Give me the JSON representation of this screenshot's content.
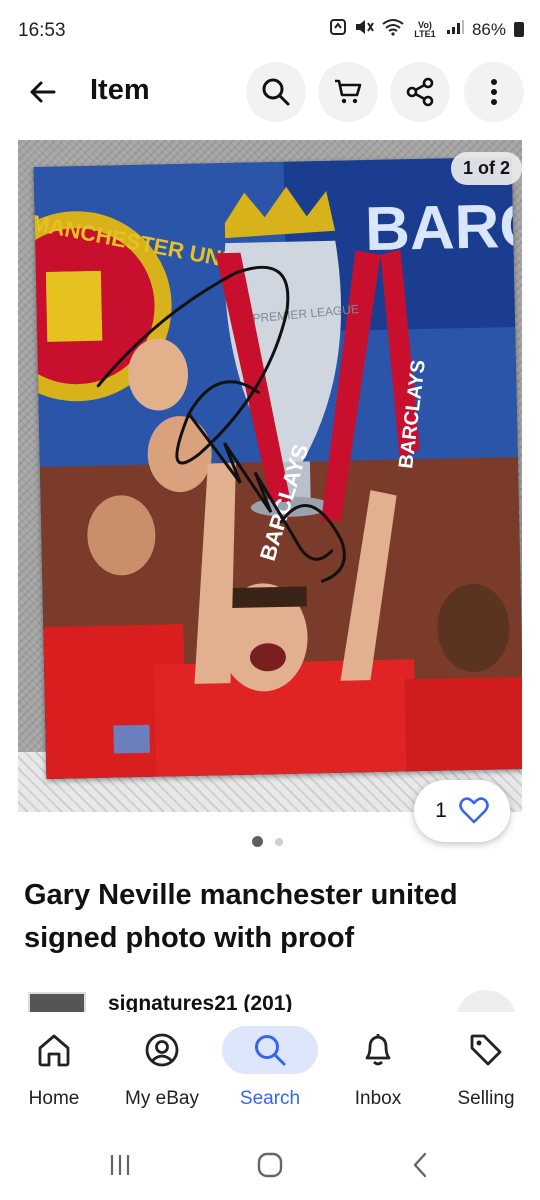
{
  "status_bar": {
    "time": "16:53",
    "network": "Vo) LTE1",
    "battery": "86%"
  },
  "app_bar": {
    "title": "Item",
    "icons": [
      "back-arrow-icon",
      "search-icon",
      "cart-icon",
      "share-icon",
      "more-vert-icon"
    ]
  },
  "gallery": {
    "counter": "1 of 2",
    "current_index": 1,
    "total": 2,
    "photo_text": {
      "club_crest": "MANCHESTER UNITED",
      "banner_top": "BARC",
      "sponsor": "BARCLAYS",
      "trophy": "PREMIER LEAGUE"
    }
  },
  "watch": {
    "count": "1"
  },
  "item": {
    "title": "Gary Neville manchester united signed photo with proof"
  },
  "seller": {
    "name": "signatures21 (201)"
  },
  "bottom_nav": {
    "items": [
      {
        "label": "Home",
        "icon": "home-icon"
      },
      {
        "label": "My eBay",
        "icon": "account-icon"
      },
      {
        "label": "Search",
        "icon": "search-icon"
      },
      {
        "label": "Inbox",
        "icon": "bell-icon"
      },
      {
        "label": "Selling",
        "icon": "tag-icon"
      }
    ],
    "active": "Search"
  },
  "colors": {
    "accent": "#3665f3",
    "active_nav_bg": "#dde6fb",
    "circle_button_bg": "#f2f2f2"
  }
}
